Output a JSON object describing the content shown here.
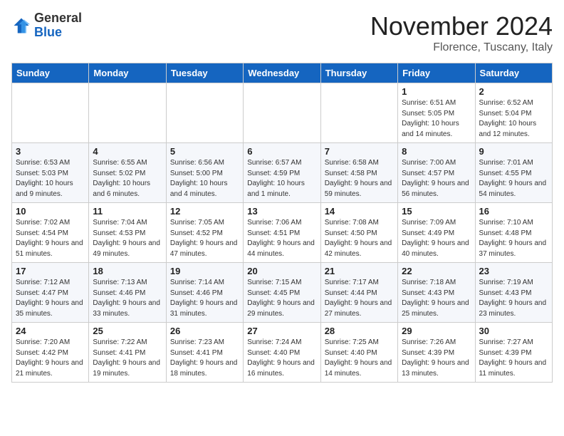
{
  "header": {
    "logo_general": "General",
    "logo_blue": "Blue",
    "month": "November 2024",
    "location": "Florence, Tuscany, Italy"
  },
  "weekdays": [
    "Sunday",
    "Monday",
    "Tuesday",
    "Wednesday",
    "Thursday",
    "Friday",
    "Saturday"
  ],
  "weeks": [
    [
      {
        "day": "",
        "info": ""
      },
      {
        "day": "",
        "info": ""
      },
      {
        "day": "",
        "info": ""
      },
      {
        "day": "",
        "info": ""
      },
      {
        "day": "",
        "info": ""
      },
      {
        "day": "1",
        "info": "Sunrise: 6:51 AM\nSunset: 5:05 PM\nDaylight: 10 hours and 14 minutes."
      },
      {
        "day": "2",
        "info": "Sunrise: 6:52 AM\nSunset: 5:04 PM\nDaylight: 10 hours and 12 minutes."
      }
    ],
    [
      {
        "day": "3",
        "info": "Sunrise: 6:53 AM\nSunset: 5:03 PM\nDaylight: 10 hours and 9 minutes."
      },
      {
        "day": "4",
        "info": "Sunrise: 6:55 AM\nSunset: 5:02 PM\nDaylight: 10 hours and 6 minutes."
      },
      {
        "day": "5",
        "info": "Sunrise: 6:56 AM\nSunset: 5:00 PM\nDaylight: 10 hours and 4 minutes."
      },
      {
        "day": "6",
        "info": "Sunrise: 6:57 AM\nSunset: 4:59 PM\nDaylight: 10 hours and 1 minute."
      },
      {
        "day": "7",
        "info": "Sunrise: 6:58 AM\nSunset: 4:58 PM\nDaylight: 9 hours and 59 minutes."
      },
      {
        "day": "8",
        "info": "Sunrise: 7:00 AM\nSunset: 4:57 PM\nDaylight: 9 hours and 56 minutes."
      },
      {
        "day": "9",
        "info": "Sunrise: 7:01 AM\nSunset: 4:55 PM\nDaylight: 9 hours and 54 minutes."
      }
    ],
    [
      {
        "day": "10",
        "info": "Sunrise: 7:02 AM\nSunset: 4:54 PM\nDaylight: 9 hours and 51 minutes."
      },
      {
        "day": "11",
        "info": "Sunrise: 7:04 AM\nSunset: 4:53 PM\nDaylight: 9 hours and 49 minutes."
      },
      {
        "day": "12",
        "info": "Sunrise: 7:05 AM\nSunset: 4:52 PM\nDaylight: 9 hours and 47 minutes."
      },
      {
        "day": "13",
        "info": "Sunrise: 7:06 AM\nSunset: 4:51 PM\nDaylight: 9 hours and 44 minutes."
      },
      {
        "day": "14",
        "info": "Sunrise: 7:08 AM\nSunset: 4:50 PM\nDaylight: 9 hours and 42 minutes."
      },
      {
        "day": "15",
        "info": "Sunrise: 7:09 AM\nSunset: 4:49 PM\nDaylight: 9 hours and 40 minutes."
      },
      {
        "day": "16",
        "info": "Sunrise: 7:10 AM\nSunset: 4:48 PM\nDaylight: 9 hours and 37 minutes."
      }
    ],
    [
      {
        "day": "17",
        "info": "Sunrise: 7:12 AM\nSunset: 4:47 PM\nDaylight: 9 hours and 35 minutes."
      },
      {
        "day": "18",
        "info": "Sunrise: 7:13 AM\nSunset: 4:46 PM\nDaylight: 9 hours and 33 minutes."
      },
      {
        "day": "19",
        "info": "Sunrise: 7:14 AM\nSunset: 4:46 PM\nDaylight: 9 hours and 31 minutes."
      },
      {
        "day": "20",
        "info": "Sunrise: 7:15 AM\nSunset: 4:45 PM\nDaylight: 9 hours and 29 minutes."
      },
      {
        "day": "21",
        "info": "Sunrise: 7:17 AM\nSunset: 4:44 PM\nDaylight: 9 hours and 27 minutes."
      },
      {
        "day": "22",
        "info": "Sunrise: 7:18 AM\nSunset: 4:43 PM\nDaylight: 9 hours and 25 minutes."
      },
      {
        "day": "23",
        "info": "Sunrise: 7:19 AM\nSunset: 4:43 PM\nDaylight: 9 hours and 23 minutes."
      }
    ],
    [
      {
        "day": "24",
        "info": "Sunrise: 7:20 AM\nSunset: 4:42 PM\nDaylight: 9 hours and 21 minutes."
      },
      {
        "day": "25",
        "info": "Sunrise: 7:22 AM\nSunset: 4:41 PM\nDaylight: 9 hours and 19 minutes."
      },
      {
        "day": "26",
        "info": "Sunrise: 7:23 AM\nSunset: 4:41 PM\nDaylight: 9 hours and 18 minutes."
      },
      {
        "day": "27",
        "info": "Sunrise: 7:24 AM\nSunset: 4:40 PM\nDaylight: 9 hours and 16 minutes."
      },
      {
        "day": "28",
        "info": "Sunrise: 7:25 AM\nSunset: 4:40 PM\nDaylight: 9 hours and 14 minutes."
      },
      {
        "day": "29",
        "info": "Sunrise: 7:26 AM\nSunset: 4:39 PM\nDaylight: 9 hours and 13 minutes."
      },
      {
        "day": "30",
        "info": "Sunrise: 7:27 AM\nSunset: 4:39 PM\nDaylight: 9 hours and 11 minutes."
      }
    ]
  ]
}
